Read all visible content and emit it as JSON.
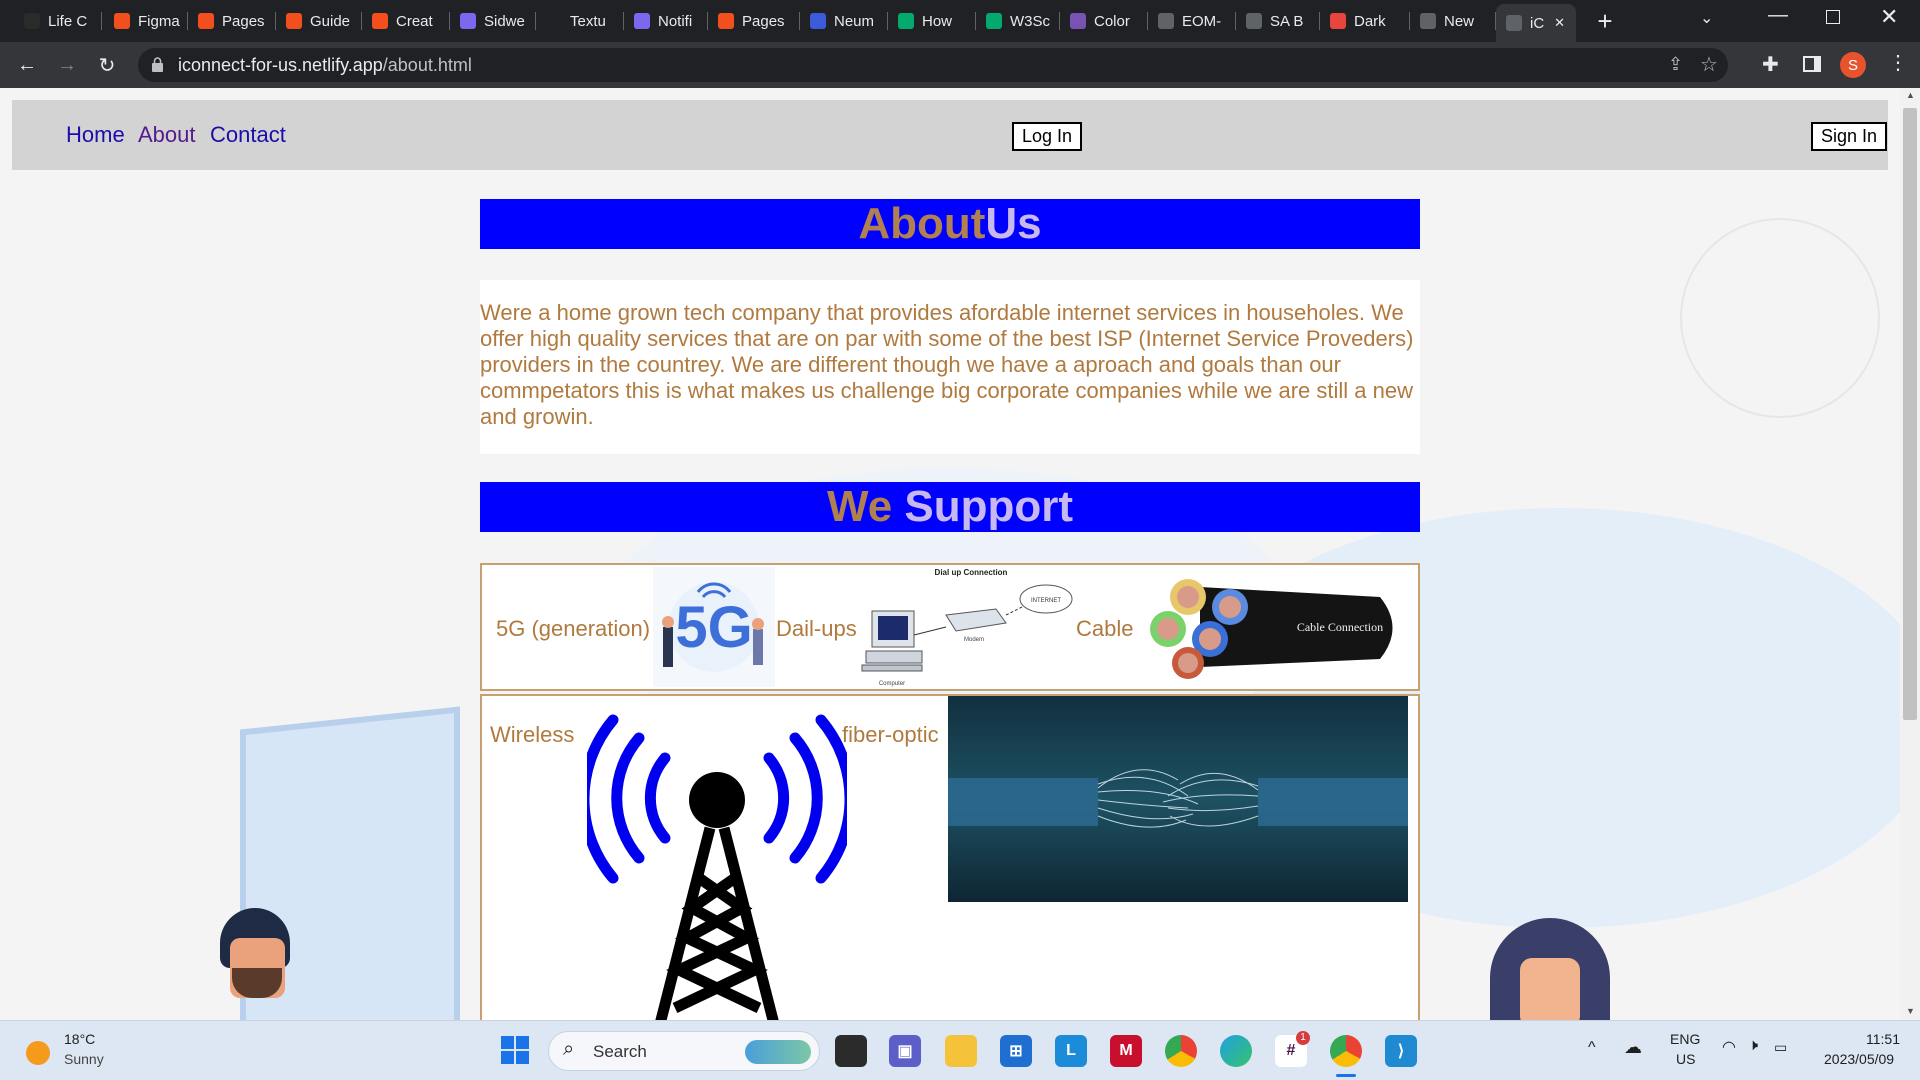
{
  "browser": {
    "tabs": [
      {
        "label": "Life C",
        "icon": "tab-favicon",
        "color": "#2a2a2a"
      },
      {
        "label": "Figma",
        "icon": "figma-icon",
        "color": "#f24e1e"
      },
      {
        "label": "Pages",
        "icon": "figma-icon",
        "color": "#f24e1e"
      },
      {
        "label": "Guide",
        "icon": "figma-icon",
        "color": "#f24e1e"
      },
      {
        "label": "Creat",
        "icon": "figma-icon",
        "color": "#f24e1e"
      },
      {
        "label": "Sidwe",
        "icon": "clickup-icon",
        "color": "#7b68ee"
      },
      {
        "label": "Textu",
        "icon": "tab-favicon",
        "color": "#202124"
      },
      {
        "label": "Notifi",
        "icon": "clickup-icon",
        "color": "#7b68ee"
      },
      {
        "label": "Pages",
        "icon": "figma-icon",
        "color": "#f24e1e"
      },
      {
        "label": "Neum",
        "icon": "tab-favicon",
        "color": "#3b5bdb"
      },
      {
        "label": "How",
        "icon": "w3schools-icon",
        "color": "#04aa6d"
      },
      {
        "label": "W3Sc",
        "icon": "w3schools-icon",
        "color": "#04aa6d"
      },
      {
        "label": "Color",
        "icon": "bootstrap-icon",
        "color": "#7952b3"
      },
      {
        "label": "EOM-",
        "icon": "globe-icon",
        "color": "#5f6368"
      },
      {
        "label": "SA B",
        "icon": "globe-icon",
        "color": "#5f6368"
      },
      {
        "label": "Dark",
        "icon": "tab-favicon",
        "color": "#e8453c"
      },
      {
        "label": "New",
        "icon": "chrome-icon",
        "color": "#5f6368"
      },
      {
        "label": "iC",
        "icon": "globe-icon",
        "color": "#5f6368"
      }
    ],
    "new_tab": "+",
    "url_host": "iconnect-for-us.netlify.app",
    "url_path": "/about.html",
    "profile_initial": "S"
  },
  "site": {
    "nav": {
      "home": "Home",
      "about": "About",
      "contact": "Contact",
      "login": "Log In",
      "signin": "Sign In"
    },
    "about": {
      "title_part1": "About",
      "title_part2": "Us",
      "body": "Were a home grown tech company that provides afordable internet services in householes. We offer high quality services that are on par with some of the best ISP (Internet Service Proveders) providers in the countrey. We are different though we have a aproach and goals than our commpetators this is what makes us challenge big corporate companies while we are still a new and growin."
    },
    "support": {
      "title_part1": "We",
      "title_part2": "Support",
      "items": {
        "fiveg": "5G (generation)",
        "dialup": "Dail-ups",
        "cable": "Cable",
        "wireless": "Wireless",
        "fiber": "fiber-optic"
      },
      "dialup_image": {
        "caption": "Dial up Connection",
        "internet": "INTERNET",
        "modem": "Modem",
        "computer": "Computer"
      },
      "cable_image_label": "Cable Connection",
      "fiveg_image_label": "5G"
    },
    "colors": {
      "bar": "#0000ff",
      "accent": "#b07a3f"
    }
  },
  "taskbar": {
    "weather_temp": "18°C",
    "weather_desc": "Sunny",
    "search_placeholder": "Search",
    "lang_line1": "ENG",
    "lang_line2": "US",
    "time": "11:51",
    "date": "2023/05/09",
    "slack_badge": "1"
  }
}
